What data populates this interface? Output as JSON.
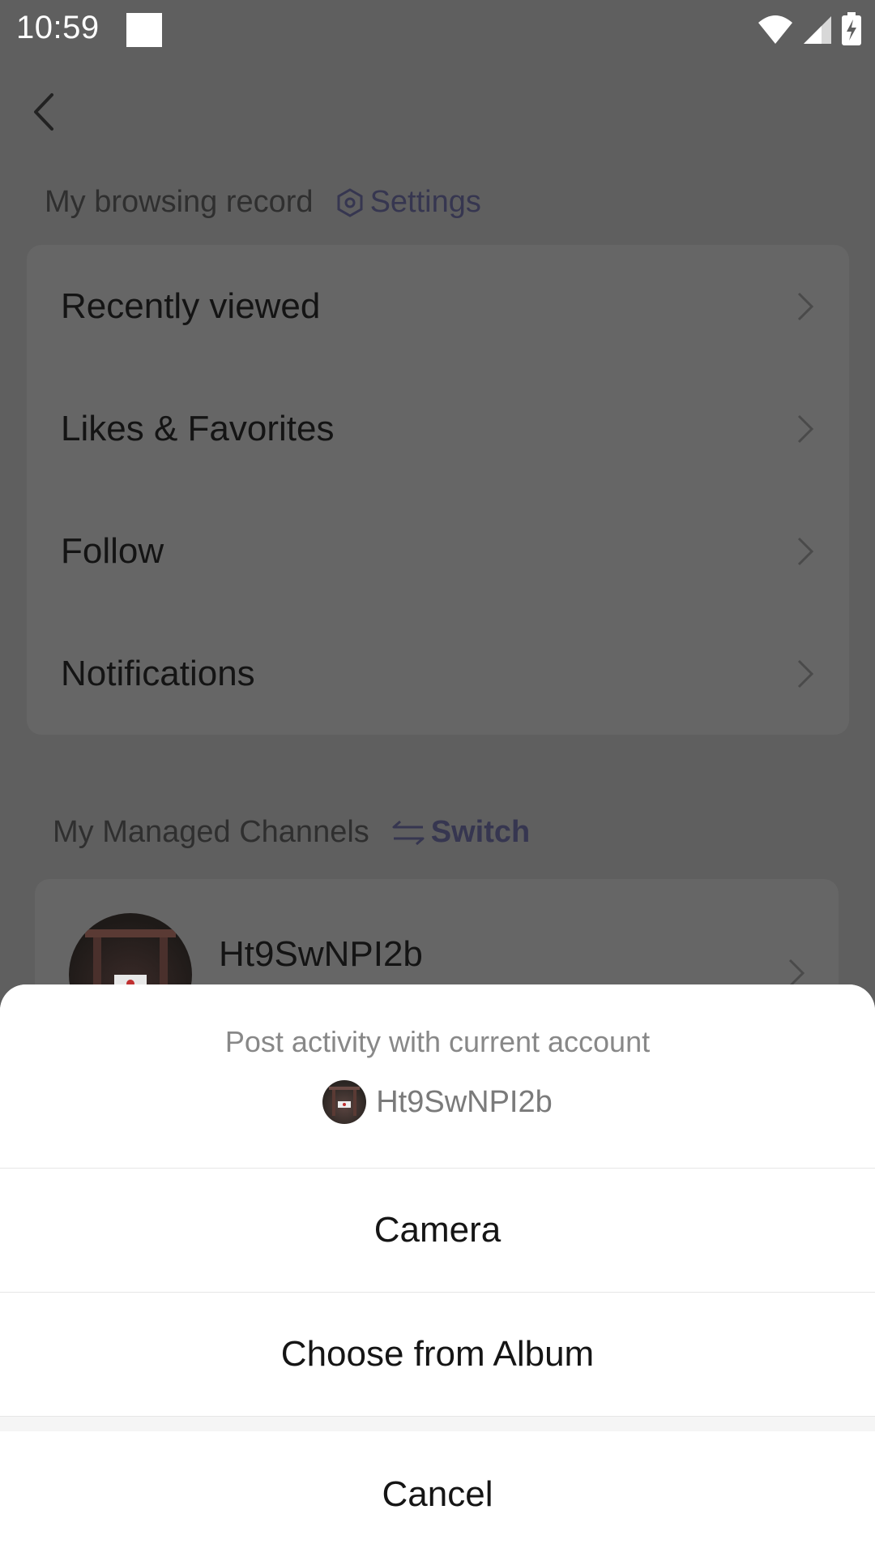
{
  "status_bar": {
    "time": "10:59"
  },
  "browsing_section": {
    "title": "My browsing record",
    "action_label": "Settings",
    "items": [
      {
        "label": "Recently viewed"
      },
      {
        "label": "Likes & Favorites"
      },
      {
        "label": "Follow"
      },
      {
        "label": "Notifications"
      }
    ]
  },
  "channels_section": {
    "title": "My Managed Channels",
    "action_label": "Switch",
    "channel": {
      "name": "Ht9SwNPI2b"
    }
  },
  "sheet": {
    "hint": "Post activity with current account",
    "account_name": "Ht9SwNPI2b",
    "options": [
      {
        "label": "Camera"
      },
      {
        "label": "Choose from Album"
      }
    ],
    "cancel_label": "Cancel"
  },
  "colors": {
    "overlay": "#5f5f5f",
    "sheet_bg": "#ffffff",
    "accent": "#363650"
  }
}
